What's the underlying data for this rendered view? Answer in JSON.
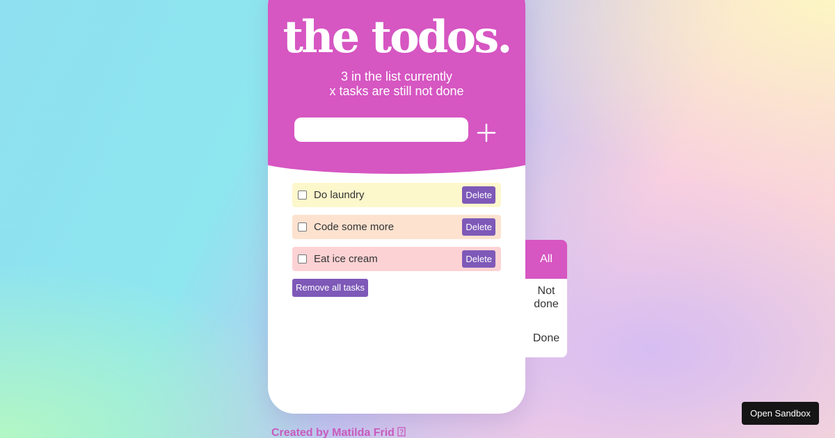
{
  "app": {
    "title": "the todos.",
    "count_text": "3 in the list currently",
    "status_text": "x tasks are still not done"
  },
  "input": {
    "value": "",
    "placeholder": "",
    "add_icon": "plus-icon"
  },
  "tasks": [
    {
      "label": "Do laundry",
      "done": false,
      "color": "#fdf7cc",
      "delete_label": "Delete"
    },
    {
      "label": "Code some more",
      "done": false,
      "color": "#fde2cf",
      "delete_label": "Delete"
    },
    {
      "label": "Eat ice cream",
      "done": false,
      "color": "#fdd2d4",
      "delete_label": "Delete"
    }
  ],
  "remove_all_label": "Remove all tasks",
  "filters": [
    {
      "label": "All",
      "active": true
    },
    {
      "label": "Not done",
      "active": false
    },
    {
      "label": "Done",
      "active": false
    }
  ],
  "footer": {
    "text": "Created by Matilda Frid",
    "icon": "external-link-icon"
  },
  "sandbox_button": "Open Sandbox",
  "colors": {
    "accent": "#d656c2",
    "button": "#7e59b8"
  }
}
